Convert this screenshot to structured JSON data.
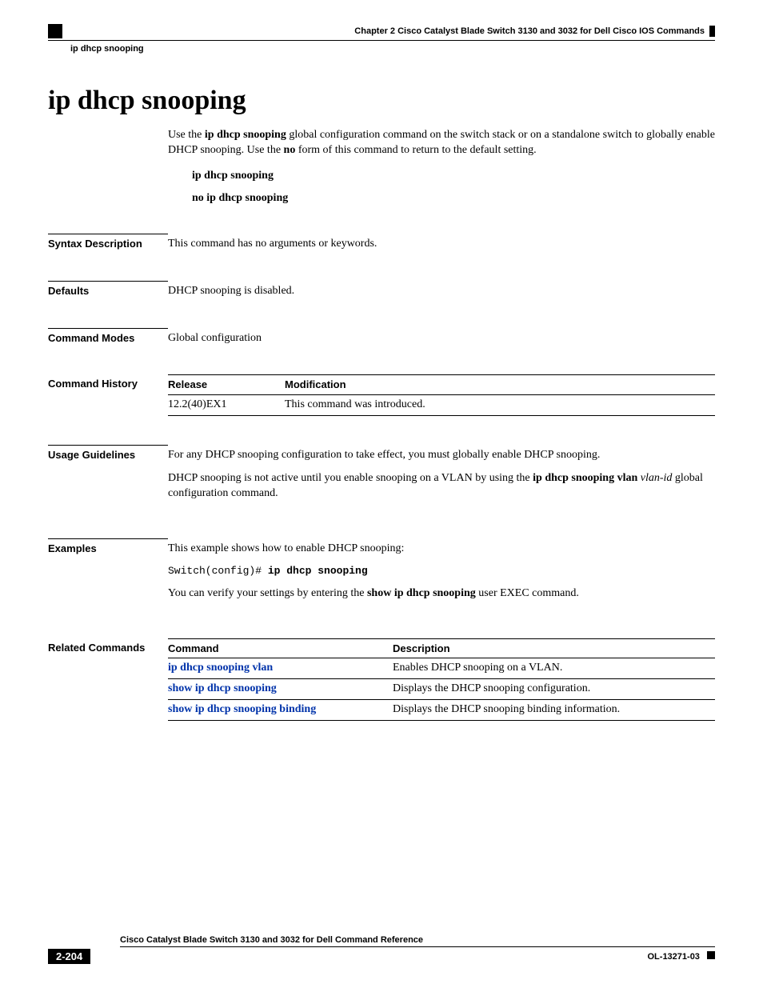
{
  "header": {
    "chapter": "Chapter 2      Cisco Catalyst Blade Switch 3130 and 3032 for Dell Cisco IOS Commands",
    "subtitle": "ip dhcp snooping"
  },
  "title": "ip dhcp snooping",
  "intro": {
    "pre1": "Use the ",
    "bold1": "ip dhcp snooping",
    "mid1": " global configuration command on the switch stack or on a standalone switch to globally enable DHCP snooping. Use the ",
    "bold2": "no",
    "post1": " form of this command to return to the default setting."
  },
  "forms": {
    "on": "ip dhcp snooping",
    "off": "no ip dhcp snooping"
  },
  "sections": {
    "syntax_label": "Syntax Description",
    "syntax_text": "This command has no arguments or keywords.",
    "defaults_label": "Defaults",
    "defaults_text": "DHCP snooping is disabled.",
    "modes_label": "Command Modes",
    "modes_text": "Global configuration",
    "history_label": "Command History",
    "history": {
      "col1": "Release",
      "col2": "Modification",
      "row1_rel": "12.2(40)EX1",
      "row1_mod": "This command was introduced."
    },
    "usage_label": "Usage Guidelines",
    "usage_p1": "For any DHCP snooping configuration to take effect, you must globally enable DHCP snooping.",
    "usage_p2_pre": "DHCP snooping is not active until you enable snooping on a VLAN by using the ",
    "usage_p2_bold": "ip dhcp snooping vlan",
    "usage_p2_mid": " ",
    "usage_p2_italic": "vlan-id",
    "usage_p2_post": " global configuration command.",
    "examples_label": "Examples",
    "examples_intro": "This example shows how to enable DHCP snooping:",
    "examples_prompt": "Switch(config)# ",
    "examples_cmd": "ip dhcp snooping",
    "examples_verify_pre": "You can verify your settings by entering the ",
    "examples_verify_bold": "show ip dhcp snooping",
    "examples_verify_post": " user EXEC command.",
    "related_label": "Related Commands",
    "related": {
      "col1": "Command",
      "col2": "Description",
      "rows": [
        {
          "cmd": "ip dhcp snooping vlan",
          "desc": "Enables DHCP snooping on a VLAN."
        },
        {
          "cmd": "show ip dhcp snooping",
          "desc": "Displays the DHCP snooping configuration."
        },
        {
          "cmd": "show ip dhcp snooping binding",
          "desc": "Displays the DHCP snooping binding information."
        }
      ]
    }
  },
  "footer": {
    "doc_title": "Cisco Catalyst Blade Switch 3130 and 3032 for Dell Command Reference",
    "page_num": "2-204",
    "doc_id": "OL-13271-03"
  }
}
